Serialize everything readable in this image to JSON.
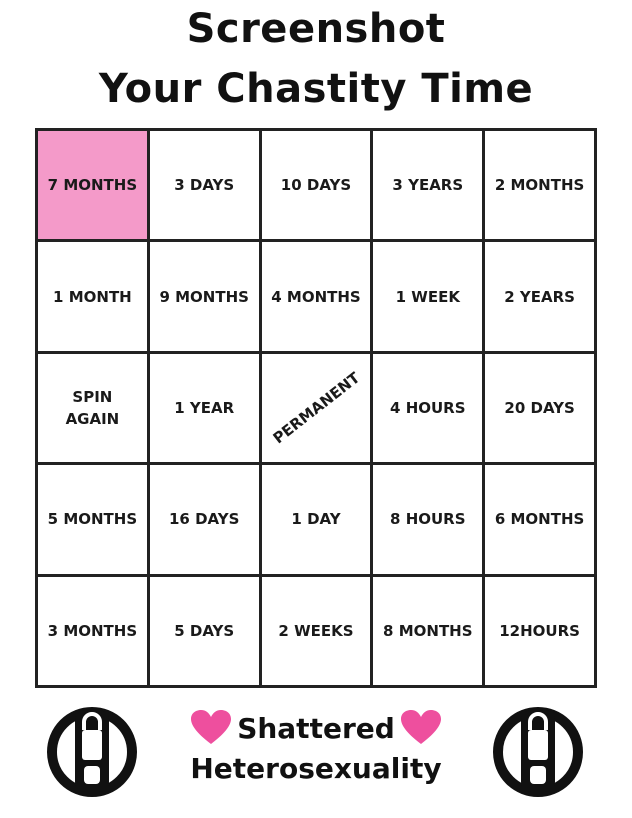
{
  "title": {
    "line1": "Screenshot",
    "line2": "Your Chastity Time"
  },
  "grid": {
    "cells": [
      "7 MONTHS",
      "3 DAYS",
      "10 DAYS",
      "3 YEARS",
      "2 MONTHS",
      "1 MONTH",
      "9 MONTHS",
      "4 MONTHS",
      "1 WEEK",
      "2 YEARS",
      "SPIN\nAGAIN",
      "1 YEAR",
      "PERMANENT",
      "4 HOURS",
      "20 DAYS",
      "5 MONTHS",
      "16 DAYS",
      "1 DAY",
      "8 HOURS",
      "6 MONTHS",
      "3 MONTHS",
      "5 DAYS",
      "2 WEEKS",
      "8 MONTHS",
      "12HOURS"
    ],
    "highlight_color": "#f49ac9"
  },
  "footer": {
    "brand_line1": "Shattered",
    "brand_line2": "Heterosexuality",
    "icons": [
      "heart-icon",
      "chastity-lock-icon"
    ],
    "heart_color": "#ee4f9e"
  }
}
